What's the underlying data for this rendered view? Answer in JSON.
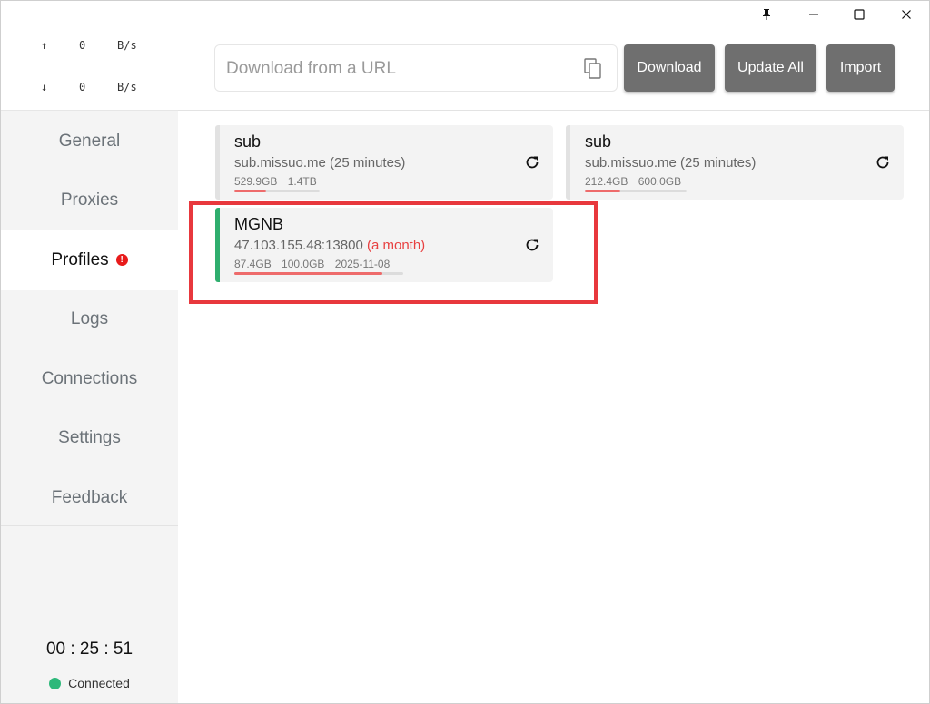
{
  "traffic": {
    "up_arrow": "↑",
    "up_value": "0",
    "up_unit": "B/s",
    "down_arrow": "↓",
    "down_value": "0",
    "down_unit": "B/s"
  },
  "nav": {
    "items": [
      {
        "label": "General"
      },
      {
        "label": "Proxies"
      },
      {
        "label": "Profiles",
        "badge": "!"
      },
      {
        "label": "Logs"
      },
      {
        "label": "Connections"
      },
      {
        "label": "Settings"
      },
      {
        "label": "Feedback"
      }
    ],
    "active": "Profiles"
  },
  "footer": {
    "timer": "00 : 25 : 51",
    "status": "Connected",
    "status_color": "#2db87a"
  },
  "toolbar": {
    "url_placeholder": "Download from a URL",
    "download_label": "Download",
    "update_all_label": "Update All",
    "import_label": "Import"
  },
  "profiles": [
    {
      "name": "sub",
      "url": "sub.missuo.me",
      "updated": "(25 minutes)",
      "used": "529.9GB",
      "total": "1.4TB",
      "expire": "",
      "usage_fraction": 0.37,
      "selected": false
    },
    {
      "name": "sub",
      "url": "sub.missuo.me",
      "updated": "(25 minutes)",
      "used": "212.4GB",
      "total": "600.0GB",
      "expire": "",
      "usage_fraction": 0.35,
      "selected": false
    },
    {
      "name": "MGNB",
      "url": "47.103.155.48:13800",
      "updated": "(a month)",
      "used": "87.4GB",
      "total": "100.0GB",
      "expire": "2025-11-08",
      "usage_fraction": 0.874,
      "selected": true
    }
  ],
  "colors": {
    "accent_selected": "#2fae6e",
    "usage_bar": "#ee6b6b",
    "warning_text": "#e84040",
    "button_bg": "#6f6f6f",
    "highlight": "#e8383d"
  }
}
